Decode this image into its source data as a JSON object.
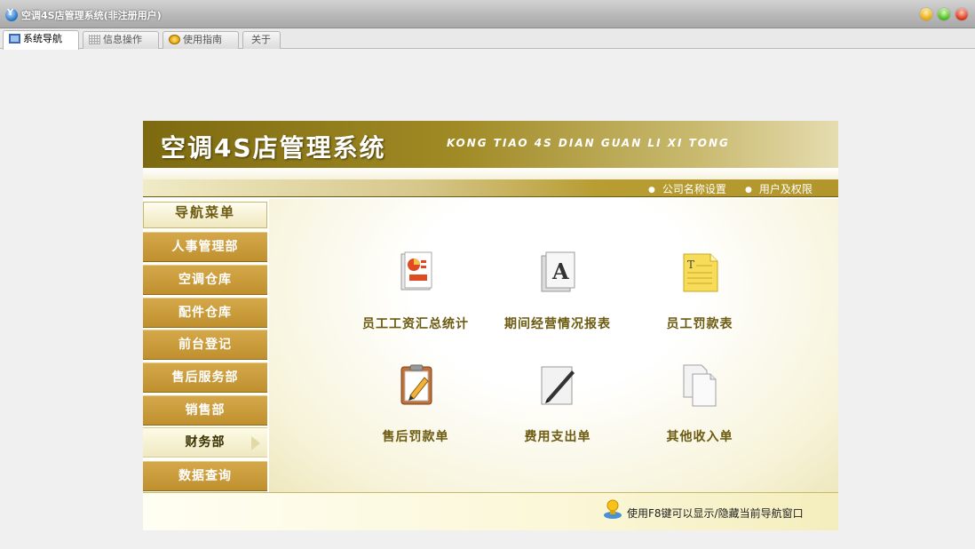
{
  "window": {
    "title": "空调4S店管理系统(非注册用户)"
  },
  "tabs": [
    {
      "label": "系统导航",
      "icon": "monitor-icon",
      "active": true
    },
    {
      "label": "信息操作",
      "icon": "grid-icon"
    },
    {
      "label": "使用指南",
      "icon": "guide-icon"
    },
    {
      "label": "关于"
    }
  ],
  "banner": {
    "title": "空调4S店管理系统",
    "subtitle": "KONG TIAO  4S DIAN GUAN LI XI TONG"
  },
  "links": {
    "company_settings": "公司名称设置",
    "user_permissions": "用户及权限"
  },
  "sidebar": {
    "header": "导航菜单",
    "items": [
      {
        "label": "人事管理部"
      },
      {
        "label": "空调仓库"
      },
      {
        "label": "配件仓库"
      },
      {
        "label": "前台登记"
      },
      {
        "label": "售后服务部"
      },
      {
        "label": "销售部"
      },
      {
        "label": "财务部",
        "selected": true
      },
      {
        "label": "数据查询"
      }
    ]
  },
  "tiles": [
    {
      "label": "员工工资汇总统计",
      "icon": "report-icon"
    },
    {
      "label": "期间经营情况报表",
      "icon": "document-a-icon"
    },
    {
      "label": "员工罚款表",
      "icon": "text-file-icon"
    },
    {
      "label": "售后罚款单",
      "icon": "clipboard-pencil-icon"
    },
    {
      "label": "费用支出单",
      "icon": "pen-paper-icon"
    },
    {
      "label": "其他收入单",
      "icon": "copy-pages-icon"
    }
  ],
  "footer": {
    "tip": "使用F8键可以显示/隐藏当前导航窗口"
  },
  "colors": {
    "accent": "#a08a25",
    "menu": "#c8982f",
    "label": "#6b5a10"
  }
}
